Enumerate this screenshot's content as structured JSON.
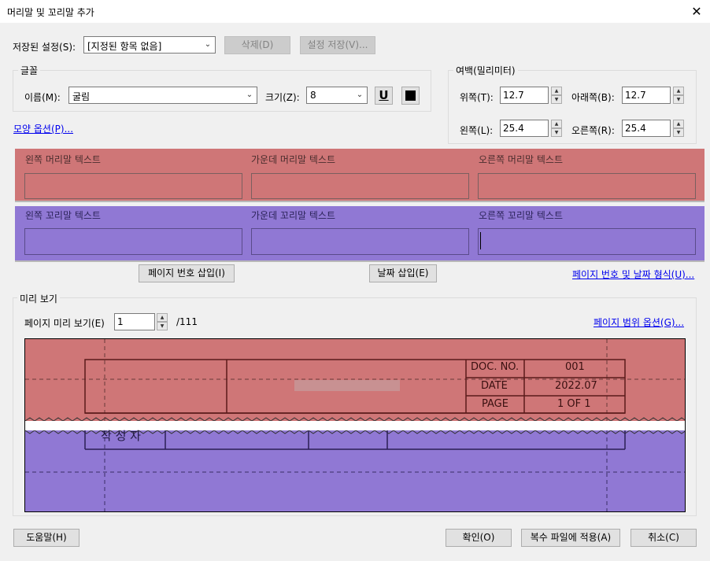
{
  "window": {
    "title": "머리말 및 꼬리말 추가"
  },
  "saved_settings": {
    "label": "저장된 설정(S):",
    "value": "[지정된 항목 없음]",
    "delete_label": "삭제(D)",
    "save_label": "설정 저장(V)..."
  },
  "font": {
    "group_label": "글꼴",
    "name_label": "이름(M):",
    "name_value": "굴림",
    "size_label": "크기(Z):",
    "size_value": "8",
    "underline_glyph": "U",
    "color": "#000000"
  },
  "margins": {
    "group_label": "여백(밀리미터)",
    "top_label": "위쪽(T):",
    "top_value": "12.7",
    "bottom_label": "아래쪽(B):",
    "bottom_value": "12.7",
    "left_label": "왼쪽(L):",
    "left_value": "25.4",
    "right_label": "오른쪽(R):",
    "right_value": "25.4"
  },
  "appearance_link": "모양 옵션(P)...",
  "header": {
    "left_label": "왼쪽 머리말 텍스트",
    "center_label": "가운데 머리말 텍스트",
    "right_label": "오른쪽 머리말 텍스트",
    "color": "#cf7677"
  },
  "footer": {
    "left_label": "왼쪽 꼬리말 텍스트",
    "center_label": "가운데 꼬리말 텍스트",
    "right_label": "오른쪽 꼬리말 텍스트",
    "color": "#9078d4"
  },
  "insert": {
    "page_number_label": "페이지 번호 삽입(I)",
    "date_label": "날짜 삽입(E)",
    "format_link": "페이지 번호 및 날짜 형식(U)..."
  },
  "preview": {
    "group_label": "미리 보기",
    "page_label": "페이지 미리 보기(E)",
    "page_value": "1",
    "page_total": "/111",
    "range_link": "페이지 범위 옵션(G)...",
    "doc_table": {
      "doc_no_label": "DOC. NO.",
      "doc_no_value": "001",
      "date_label": "DATE",
      "date_value": "2022.07",
      "page_label": "PAGE",
      "page_value": "1 OF 1"
    },
    "author_text": "작 성 자"
  },
  "buttons": {
    "help": "도움말(H)",
    "ok": "확인(O)",
    "apply_multiple": "복수 파일에 적용(A)",
    "cancel": "취소(C)"
  }
}
